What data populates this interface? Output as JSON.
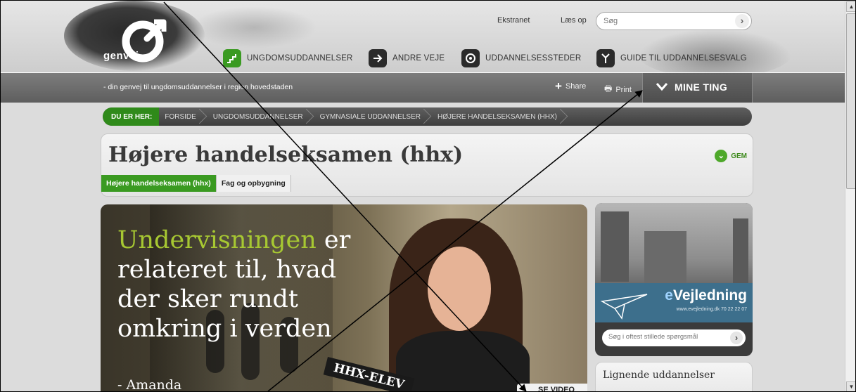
{
  "header": {
    "logo_text": "genvej",
    "toplinks": [
      "Ekstranet",
      "Læs op"
    ],
    "search_placeholder": "Søg",
    "nav": [
      {
        "label": "UNGDOMSUDDANNELSER",
        "icon": "stairs-icon",
        "color": "#3a9a21"
      },
      {
        "label": "ANDRE VEJE",
        "icon": "arrow-right-icon",
        "color": "#2b2b2b"
      },
      {
        "label": "UDDANNELSESSTEDER",
        "icon": "target-icon",
        "color": "#2b2b2b"
      },
      {
        "label": "GUIDE TIL UDDANNELSESVALG",
        "icon": "fork-icon",
        "color": "#2b2b2b"
      }
    ]
  },
  "graybar": {
    "tagline": "- din genvej til ungdomsuddannelser i region hovedstaden",
    "share": "Share",
    "print": "Print",
    "mine_ting": "MINE TING"
  },
  "breadcrumb": {
    "prefix": "DU ER HER:",
    "items": [
      "FORSIDE",
      "UNGDOMSUDDANNELSER",
      "GYMNASIALE UDDANNELSER",
      "HØJERE HANDELSEKSAMEN (HHX)"
    ]
  },
  "page": {
    "title": "Højere handelseksamen (hhx)",
    "gem": "GEM",
    "tabs": [
      "Højere handelseksamen (hhx)",
      "Fag og opbygning"
    ]
  },
  "hero": {
    "quote_highlight": "Undervisningen",
    "quote_rest": " er relateret til, hvad der sker rundt omkring i verden",
    "author": "- Amanda",
    "badge": "HHX-ELEV",
    "video_label": "SE VIDEO"
  },
  "sidebar": {
    "evejledning_prefix": "e",
    "evejledning_rest": "Vejledning",
    "evejledning_sub": "www.evejledning.dk 70 22 22 07",
    "faq_placeholder": "Søg i oftest stillede spørgsmål",
    "similar_title": "Lignende uddannelser"
  }
}
